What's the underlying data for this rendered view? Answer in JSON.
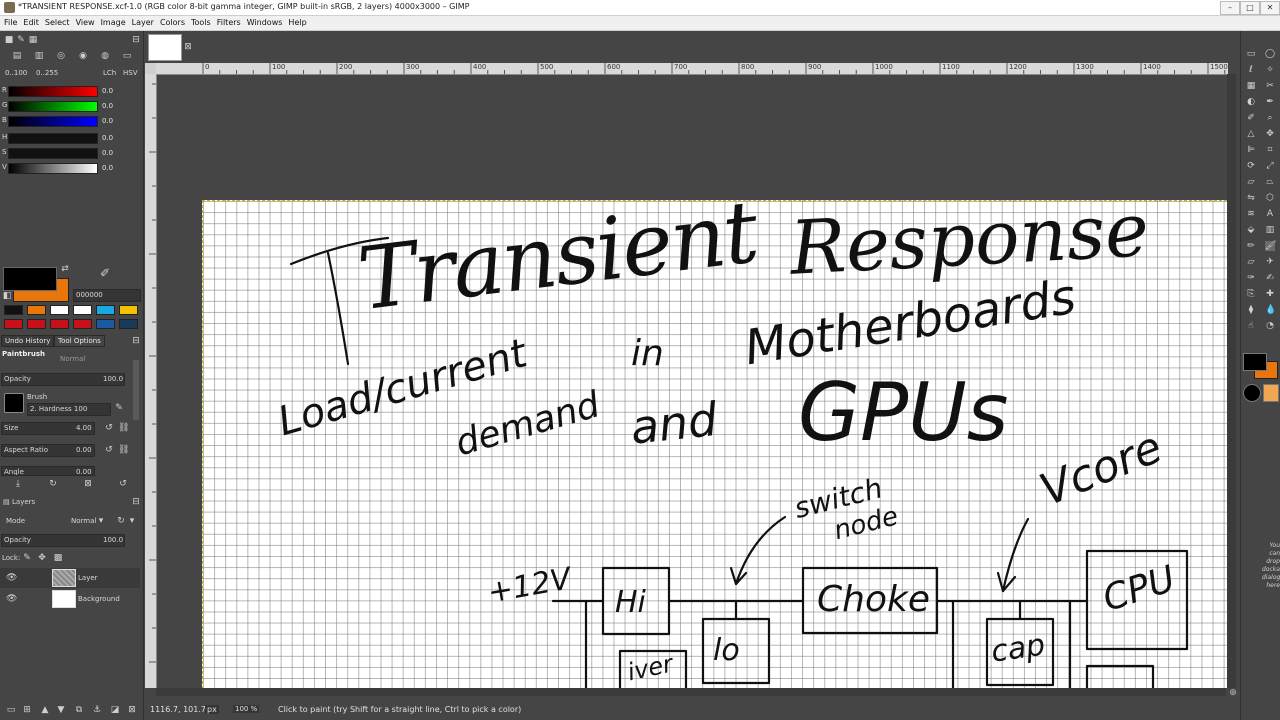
{
  "window": {
    "title": "*TRANSIENT RESPONSE.xcf-1.0 (RGB color 8-bit gamma integer, GIMP built-in sRGB, 2 layers) 4000x3000 – GIMP"
  },
  "menu": [
    "File",
    "Edit",
    "Select",
    "View",
    "Image",
    "Layer",
    "Colors",
    "Tools",
    "Filters",
    "Windows",
    "Help"
  ],
  "color_panel": {
    "range_left": "0..100",
    "range_right": "0..255",
    "mode_lch": "LCh",
    "mode_hsv": "HSV",
    "channels": [
      {
        "label": "R",
        "value": "0.0",
        "color": "#d40000"
      },
      {
        "label": "G",
        "value": "0.0",
        "color": "#00c800"
      },
      {
        "label": "B",
        "value": "0.0",
        "color": "#0000d0"
      },
      {
        "label": "H",
        "value": "0.0",
        "color": "#111111"
      },
      {
        "label": "S",
        "value": "0.0",
        "color": "#111111"
      },
      {
        "label": "V",
        "value": "0.0",
        "color": "#cfcfcf"
      }
    ],
    "hex": "000000",
    "fg_color": "#000000",
    "bg_color": "#e8760a",
    "history_colors_row1": [
      "#111111",
      "#e8760a",
      "#ffffff",
      "#ffffff",
      "#1aa8e0",
      "#f2c200"
    ],
    "history_colors_row2": [
      "#c8101a",
      "#c8101a",
      "#c8101a",
      "#c8101a",
      "#1a5aa0",
      "#1a3a5a"
    ]
  },
  "tool_options": {
    "tab_undo": "Undo History",
    "tab_tool": "Tool Options",
    "tool_name": "Paintbrush",
    "mode_value": "Normal",
    "opacity_label": "Opacity",
    "opacity_value": "100.0",
    "brush_label": "Brush",
    "brush_name": "2. Hardness 100",
    "size_label": "Size",
    "size_value": "4.00",
    "aspect_label": "Aspect Ratio",
    "aspect_value": "0.00",
    "angle_label": "Angle",
    "angle_value": "0.00"
  },
  "layers_panel": {
    "title": "Layers",
    "mode_label": "Mode",
    "mode_value": "Normal",
    "opacity_label": "Opacity",
    "opacity_value": "100.0",
    "lock_label": "Lock:",
    "layers": [
      {
        "name": "Layer"
      },
      {
        "name": "Background"
      }
    ]
  },
  "ruler_ticks": [
    "0",
    "100",
    "200",
    "300",
    "400",
    "500",
    "600",
    "700",
    "800",
    "900",
    "1000",
    "1100",
    "1200",
    "1300",
    "1400",
    "1500"
  ],
  "status": {
    "coords": "1116.7, 101.7",
    "unit": "px",
    "zoom": "100 %",
    "message": "Click to paint (try Shift for a straight line, Ctrl to pick a color)"
  },
  "drop_hint": "You can drop dockable dialogs here",
  "drawing_text": {
    "title1": "Transient",
    "title2": "Response",
    "line_load": "Load/current",
    "line_demand": "demand",
    "line_in": "in",
    "line_mobo": "Motherboards",
    "line_and": "and",
    "line_gpus": "GPUs",
    "switch": "switch",
    "node": "node",
    "vcore": "Vcore",
    "v12": "+12V",
    "hi": "Hi",
    "lo": "lo",
    "choke": "Choke",
    "cap": "cap",
    "cpu": "CPU",
    "driver": "iver"
  }
}
